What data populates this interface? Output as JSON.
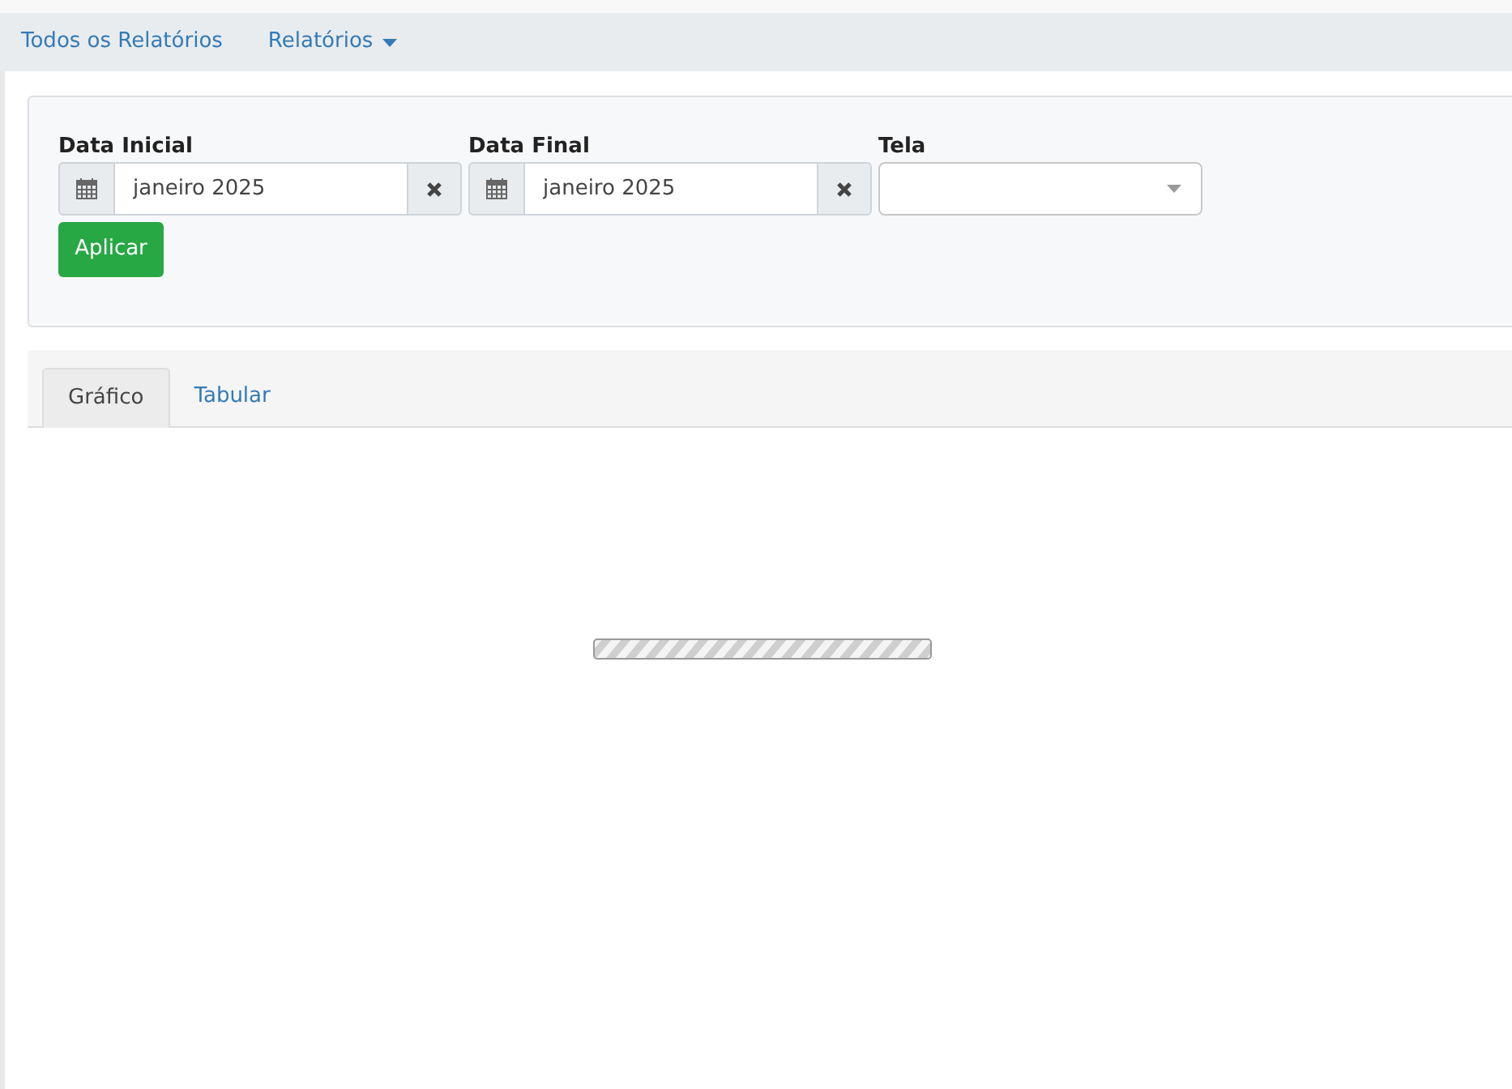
{
  "nav": [
    {
      "label": "Todos os Relatórios",
      "kind": "link"
    },
    {
      "label": "Relatórios",
      "kind": "dropdown"
    }
  ],
  "filters": [
    {
      "label": "Data Inicial",
      "kind": "date",
      "value": "janeiro 2025"
    },
    {
      "label": "Data Final",
      "kind": "date",
      "value": "janeiro 2025"
    },
    {
      "label": "Tela",
      "kind": "select"
    }
  ],
  "apply_button": "Aplicar",
  "tabs": [
    {
      "label": "Gráfico",
      "selected": true
    },
    {
      "label": "Tabular",
      "selected": false
    }
  ]
}
